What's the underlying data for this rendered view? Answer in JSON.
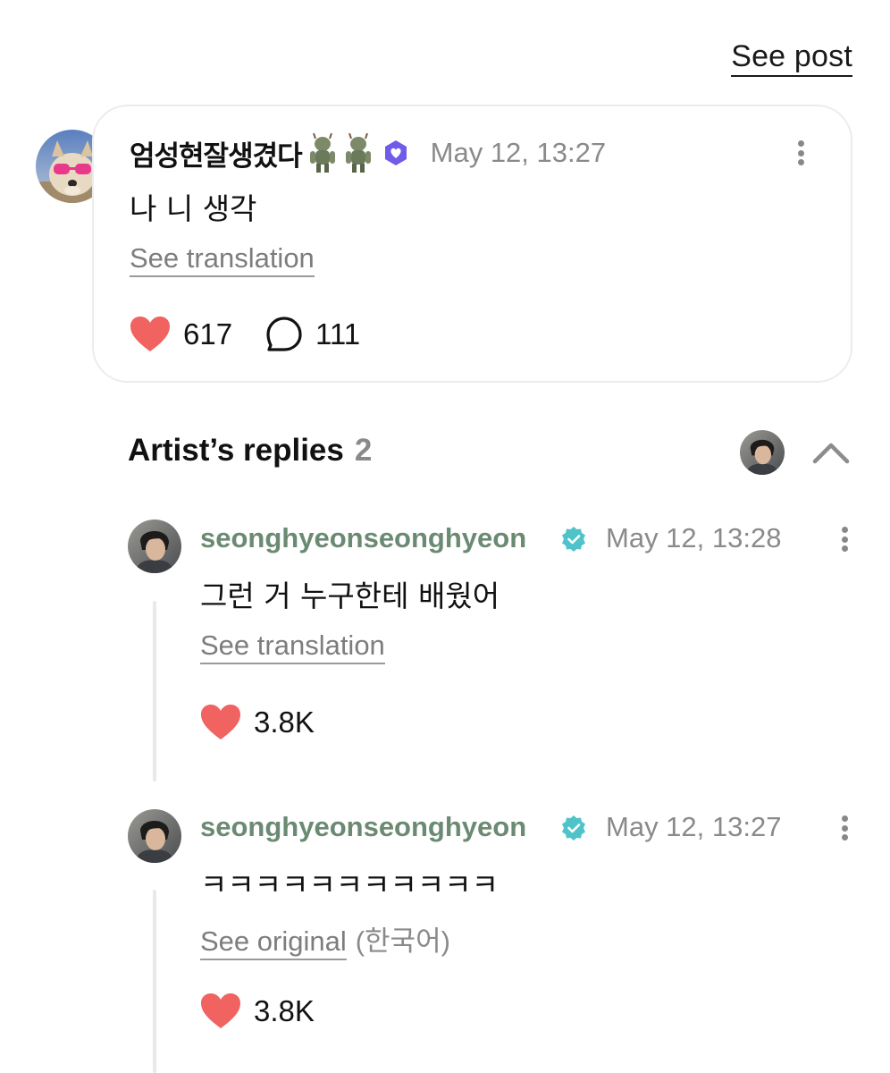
{
  "header": {
    "see_post": "See post"
  },
  "post": {
    "author": "엄성현잘생겼다",
    "author_emoji": [
      "troll-figure-icon",
      "troll-figure-icon"
    ],
    "time": "May 12, 13:27",
    "body": "나 니 생각",
    "see_translation": "See translation",
    "likes": "617",
    "comments": "111"
  },
  "artist_replies": {
    "title": "Artist’s replies",
    "count": "2",
    "items": [
      {
        "name": "seonghyeonseonghyeon",
        "time": "May 12, 13:28",
        "text": "그런 거 누구한테 배웠어",
        "link": "See translation",
        "lang": "",
        "likes": "3.8K"
      },
      {
        "name": "seonghyeonseonghyeon",
        "time": "May 12, 13:27",
        "text": "ㅋㅋㅋㅋㅋㅋㅋㅋㅋㅋㅋ",
        "link": "See original",
        "lang": "(한국어)",
        "likes": "3.8K"
      }
    ]
  },
  "colors": {
    "heart": "#f06360",
    "verified_teal": "#4fc3c9",
    "fan_badge": "#6f5ce8",
    "artist_name": "#6a8a72"
  }
}
